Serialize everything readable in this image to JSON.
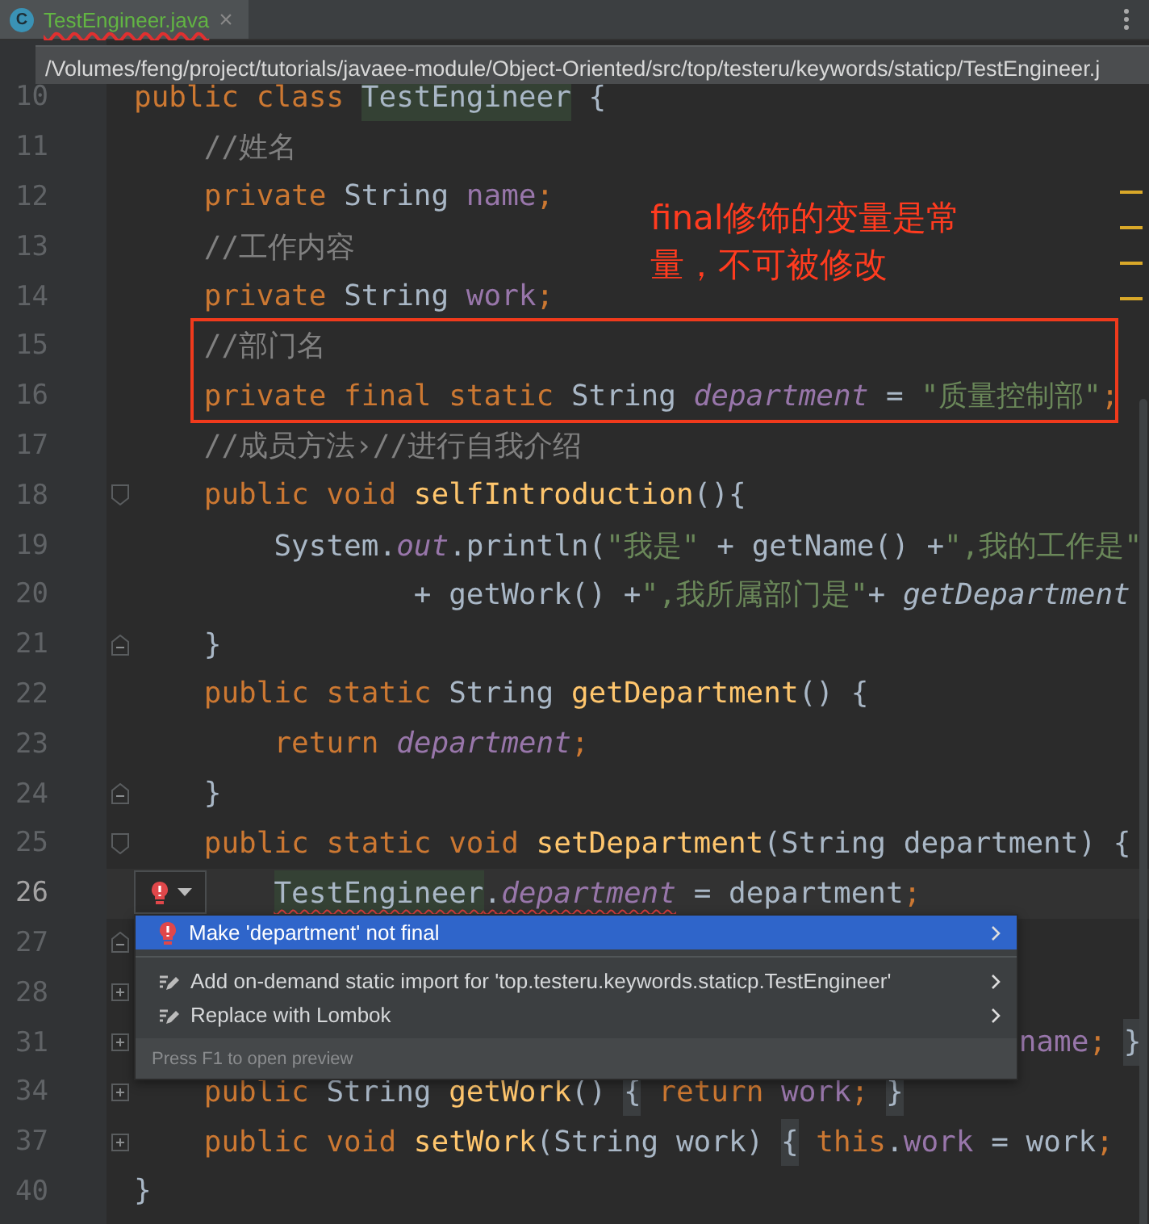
{
  "tab": {
    "icon_letter": "C",
    "label": "TestEngineer.java",
    "selected": true,
    "error": true,
    "close": "×"
  },
  "path_tooltip": "/Volumes/feng/project/tutorials/javaee-module/Object-Oriented/src/top/testeru/keywords/staticp/TestEngineer.j",
  "lines": [
    {
      "number": "10",
      "tokens": [
        {
          "t": "public class ",
          "kind": "kw"
        },
        {
          "t": "TestEngineer",
          "kind": "plain",
          "hl": true
        },
        {
          "t": " {",
          "kind": "plain"
        }
      ]
    },
    {
      "number": "11",
      "tokens": [
        {
          "t": "    //姓名",
          "kind": "comment"
        }
      ]
    },
    {
      "number": "12",
      "tokens": [
        {
          "t": "    private ",
          "kind": "kw"
        },
        {
          "t": "String ",
          "kind": "plain"
        },
        {
          "t": "name",
          "kind": "field"
        },
        {
          "t": ";",
          "kind": "kw"
        }
      ]
    },
    {
      "number": "13",
      "tokens": [
        {
          "t": "    //工作内容",
          "kind": "comment"
        }
      ]
    },
    {
      "number": "14",
      "tokens": [
        {
          "t": "    private ",
          "kind": "kw"
        },
        {
          "t": "String ",
          "kind": "plain"
        },
        {
          "t": "work",
          "kind": "field"
        },
        {
          "t": ";",
          "kind": "kw"
        }
      ]
    },
    {
      "number": "15",
      "tokens": [
        {
          "t": "    //部门名",
          "kind": "comment"
        }
      ]
    },
    {
      "number": "16",
      "tokens": [
        {
          "t": "    private final static ",
          "kind": "kw"
        },
        {
          "t": "String ",
          "kind": "plain"
        },
        {
          "t": "department",
          "kind": "static"
        },
        {
          "t": " = ",
          "kind": "plain"
        },
        {
          "t": "\"质量控制部\"",
          "kind": "str"
        },
        {
          "t": ";",
          "kind": "kw"
        }
      ]
    },
    {
      "number": "17",
      "tokens": [
        {
          "t": "    //成员方法›//进行自我介绍",
          "kind": "comment"
        }
      ]
    },
    {
      "number": "18",
      "fold": {
        "kind": "start"
      },
      "tokens": [
        {
          "t": "    public void ",
          "kind": "kw"
        },
        {
          "t": "selfIntroduction",
          "kind": "method"
        },
        {
          "t": "(){",
          "kind": "plain"
        }
      ]
    },
    {
      "number": "19",
      "tokens": [
        {
          "t": "        System.",
          "kind": "plain"
        },
        {
          "t": "out",
          "kind": "static"
        },
        {
          "t": ".println(",
          "kind": "plain"
        },
        {
          "t": "\"我是\"",
          "kind": "str"
        },
        {
          "t": " + getName() +",
          "kind": "plain"
        },
        {
          "t": "\",我的工作是\"",
          "kind": "str"
        }
      ]
    },
    {
      "number": "20",
      "tokens": [
        {
          "t": "                + getWork() +",
          "kind": "plain"
        },
        {
          "t": "\",我所属部门是\"",
          "kind": "str"
        },
        {
          "t": "+ ",
          "kind": "plain"
        },
        {
          "t": "getDepartment",
          "kind": "call"
        }
      ]
    },
    {
      "number": "21",
      "fold": {
        "kind": "end"
      },
      "tokens": [
        {
          "t": "    }",
          "kind": "plain"
        }
      ]
    },
    {
      "number": "22",
      "tokens": [
        {
          "t": "    public static ",
          "kind": "kw"
        },
        {
          "t": "String ",
          "kind": "plain"
        },
        {
          "t": "getDepartment",
          "kind": "method"
        },
        {
          "t": "() {",
          "kind": "plain"
        }
      ]
    },
    {
      "number": "23",
      "tokens": [
        {
          "t": "        return ",
          "kind": "kw"
        },
        {
          "t": "department",
          "kind": "static"
        },
        {
          "t": ";",
          "kind": "kw"
        }
      ]
    },
    {
      "number": "24",
      "fold": {
        "kind": "end"
      },
      "tokens": [
        {
          "t": "    }",
          "kind": "plain"
        }
      ]
    },
    {
      "number": "25",
      "fold": {
        "kind": "start"
      },
      "tokens": [
        {
          "t": "    public static void ",
          "kind": "kw"
        },
        {
          "t": "setDepartment",
          "kind": "method"
        },
        {
          "t": "(String department) {",
          "kind": "plain"
        }
      ]
    },
    {
      "number": "26",
      "current": true,
      "tokens": [
        {
          "t": "        TestEngineer",
          "kind": "plain",
          "hl": true,
          "error": true
        },
        {
          "t": ".",
          "kind": "plain",
          "error": true
        },
        {
          "t": "department",
          "kind": "static",
          "error": true
        },
        {
          "t": " = department",
          "kind": "plain"
        },
        {
          "t": ";",
          "kind": "kw"
        }
      ]
    },
    {
      "number": "27",
      "fold": {
        "kind": "end"
      }
    },
    {
      "number": "28",
      "fold": {
        "kind": "collapsed"
      }
    },
    {
      "number": "31",
      "fold": {
        "kind": "collapsed"
      },
      "covered": true,
      "tokens": [
        {
          "t": "name",
          "kind": "field"
        },
        {
          "t": "; ",
          "kind": "kw"
        },
        {
          "t": "}",
          "kind": "brace"
        }
      ]
    },
    {
      "number": "34",
      "fold": {
        "kind": "collapsed"
      },
      "tokens": [
        {
          "t": "    public ",
          "kind": "kw"
        },
        {
          "t": "String ",
          "kind": "plain"
        },
        {
          "t": "getWork",
          "kind": "method"
        },
        {
          "t": "() ",
          "kind": "plain"
        },
        {
          "t": "{",
          "kind": "brace"
        },
        {
          "t": " return ",
          "kind": "kw"
        },
        {
          "t": "work",
          "kind": "field"
        },
        {
          "t": "; ",
          "kind": "kw"
        },
        {
          "t": "}",
          "kind": "brace"
        }
      ]
    },
    {
      "number": "37",
      "fold": {
        "kind": "collapsed"
      },
      "tokens": [
        {
          "t": "    public void ",
          "kind": "kw"
        },
        {
          "t": "setWork",
          "kind": "method"
        },
        {
          "t": "(String work) ",
          "kind": "plain"
        },
        {
          "t": "{",
          "kind": "brace"
        },
        {
          "t": " this",
          "kind": "kw"
        },
        {
          "t": ".",
          "kind": "plain"
        },
        {
          "t": "work",
          "kind": "field"
        },
        {
          "t": " = work",
          "kind": "plain"
        },
        {
          "t": ";",
          "kind": "kw"
        }
      ]
    },
    {
      "number": "40",
      "tokens": [
        {
          "t": "}",
          "kind": "plain"
        }
      ]
    }
  ],
  "annotation": "final修饰的变量是常量，不可被修改",
  "intention_menu": {
    "items": [
      {
        "label": "Make 'department' not final",
        "kind": "quickfix",
        "selected": true
      },
      {
        "label": "Add on-demand static import for 'top.testeru.keywords.staticp.TestEngineer'",
        "kind": "intention",
        "selected": false
      },
      {
        "label": "Replace with Lombok",
        "kind": "intention",
        "selected": false
      }
    ],
    "footer": "Press F1 to open preview"
  }
}
